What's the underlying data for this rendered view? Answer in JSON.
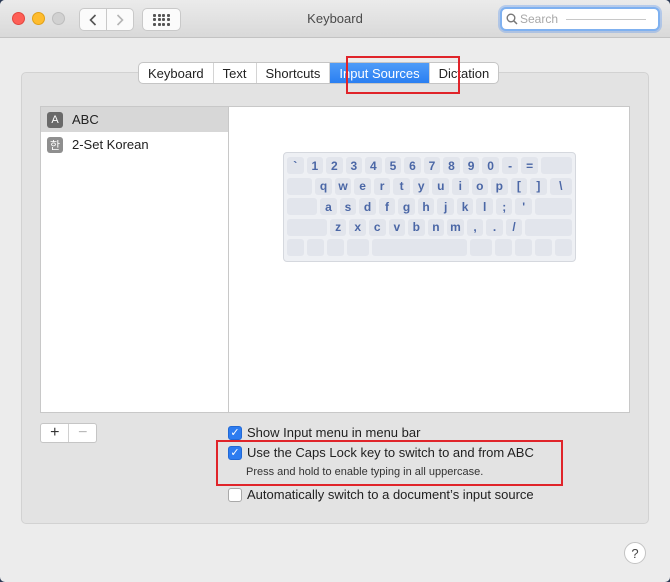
{
  "window": {
    "title": "Keyboard"
  },
  "search": {
    "placeholder": "Search"
  },
  "tabs": [
    {
      "label": "Keyboard"
    },
    {
      "label": "Text"
    },
    {
      "label": "Shortcuts"
    },
    {
      "label": "Input Sources",
      "active": true
    },
    {
      "label": "Dictation"
    }
  ],
  "sources": [
    {
      "icon": "A",
      "label": "ABC",
      "selected": true
    },
    {
      "icon": "한",
      "label": "2-Set Korean",
      "selected": false
    }
  ],
  "keyboard": {
    "rows": [
      [
        "`",
        "1",
        "2",
        "3",
        "4",
        "5",
        "6",
        "7",
        "8",
        "9",
        "0",
        "-",
        "="
      ],
      [
        "q",
        "w",
        "e",
        "r",
        "t",
        "y",
        "u",
        "i",
        "o",
        "p",
        "[",
        "]",
        "\\"
      ],
      [
        "a",
        "s",
        "d",
        "f",
        "g",
        "h",
        "j",
        "k",
        "l",
        ";",
        "'"
      ],
      [
        "z",
        "x",
        "c",
        "v",
        "b",
        "n",
        "m",
        ",",
        ".",
        "/"
      ]
    ]
  },
  "buttons": {
    "add": "+",
    "remove": "−"
  },
  "options": {
    "show_menu": {
      "label": "Show Input menu in menu bar",
      "checked": true
    },
    "caps_lock": {
      "label": "Use the Caps Lock key to switch to and from ABC",
      "checked": true,
      "note": "Press and hold to enable typing in all uppercase."
    },
    "auto_switch": {
      "label": "Automatically switch to a document’s input source",
      "checked": false
    }
  },
  "help": {
    "label": "?"
  },
  "colors": {
    "accent": "#2d7cf0",
    "highlight_box": "#e0242a"
  }
}
